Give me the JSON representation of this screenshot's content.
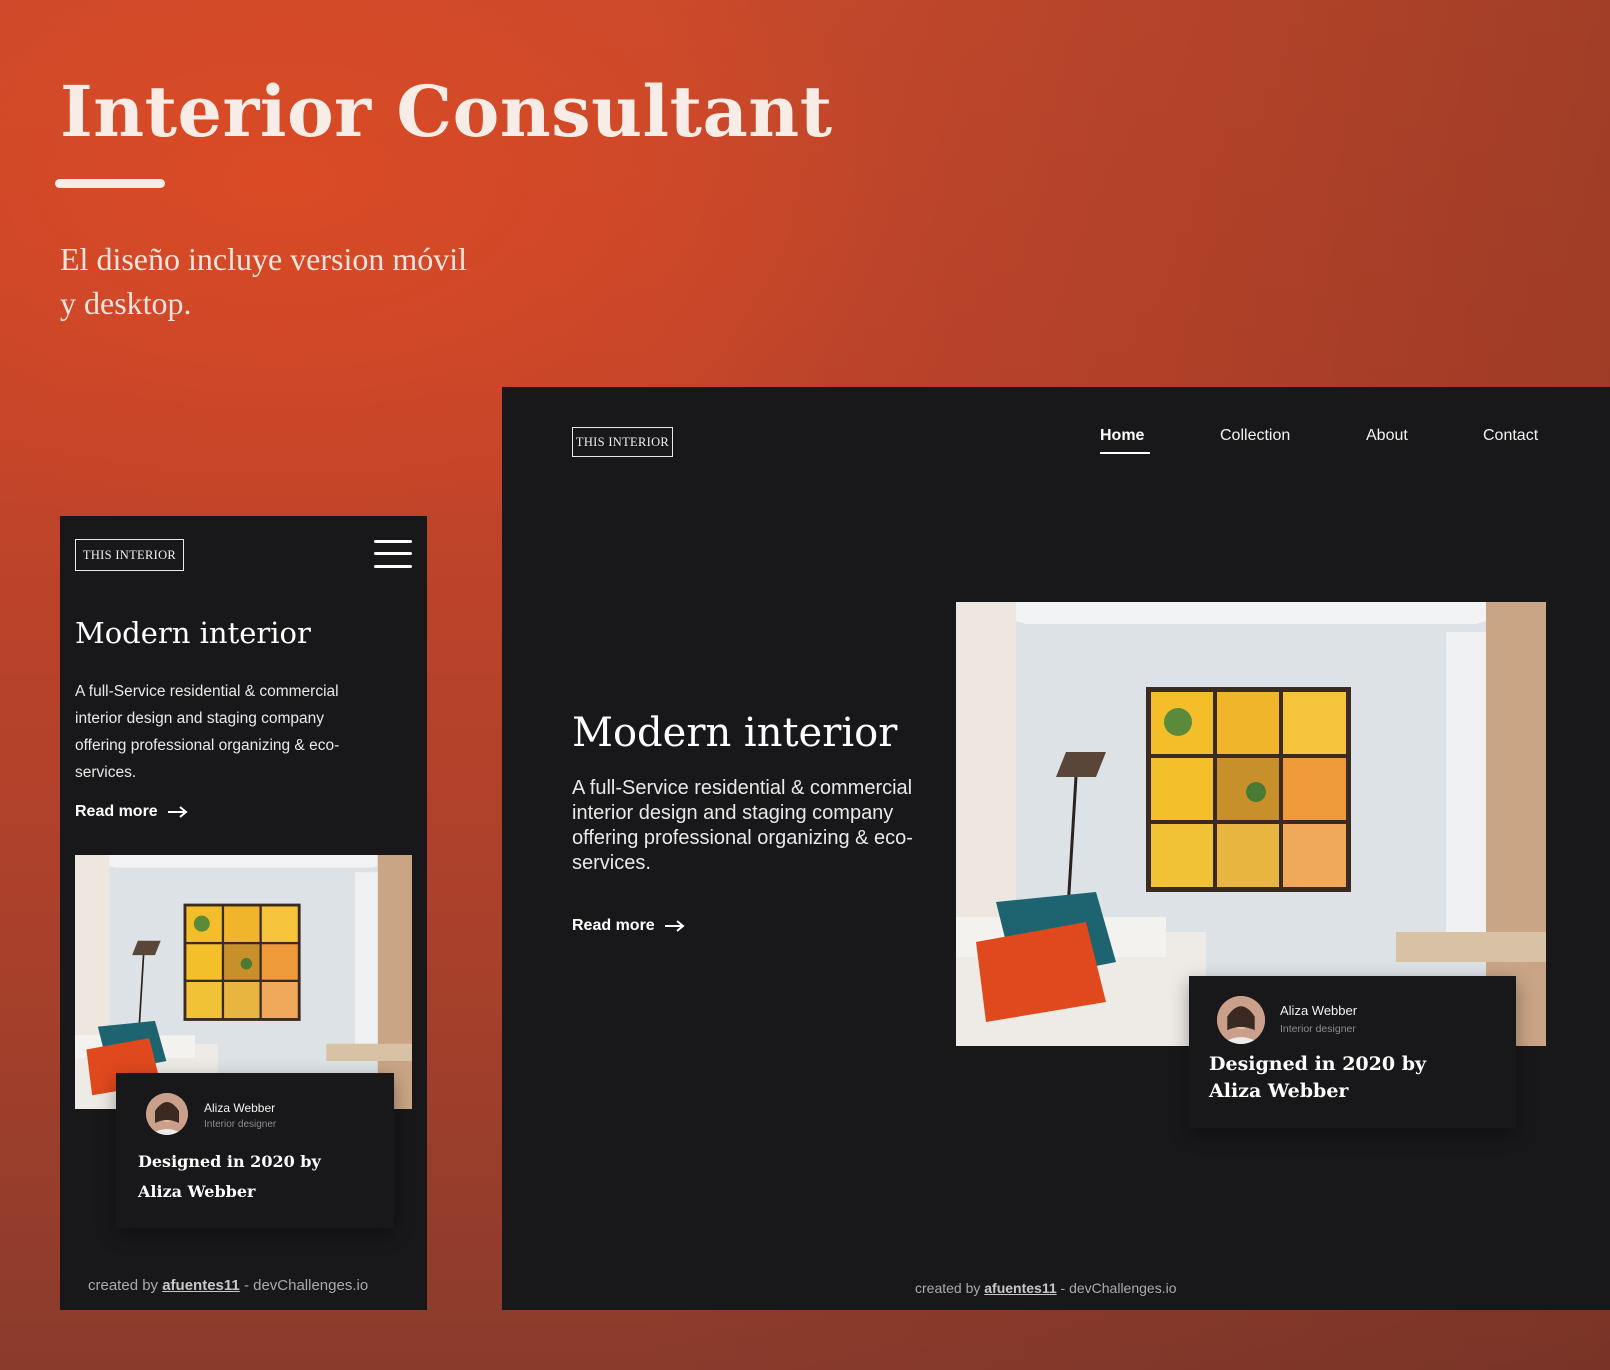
{
  "hero": {
    "title": "Interior Consultant",
    "subtitle": "El diseño incluye version móvil y desktop."
  },
  "brand": {
    "logo_text": "THIS INTERIOR"
  },
  "mobile": {
    "heading": "Modern interior",
    "paragraph": "A full-Service residential & commercial interior design and staging company offering professional organizing & eco-services.",
    "read_more": "Read more",
    "menu_icon": "hamburger-icon"
  },
  "desktop": {
    "nav": [
      "Home",
      "Collection",
      "About",
      "Contact"
    ],
    "active_nav": "Home",
    "heading": "Modern interior",
    "paragraph": "A full-Service residential & commercial interior design and staging company offering professional organizing & eco-services.",
    "read_more": "Read more"
  },
  "designer_card": {
    "name": "Aliza Webber",
    "role": "Interior designer",
    "title_line1": "Designed in 2020 by",
    "title_line2": "Aliza Webber"
  },
  "footer": {
    "prefix": "created by",
    "author": "afuentes11",
    "suffix": "- devChallenges.io"
  },
  "colors": {
    "background": "#c2442a",
    "frame": "#18181a",
    "text": "#ffffff",
    "pillow_orange": "#e0491e",
    "pillow_teal": "#1e6470",
    "artwork_yellow": "#f3be2a"
  }
}
